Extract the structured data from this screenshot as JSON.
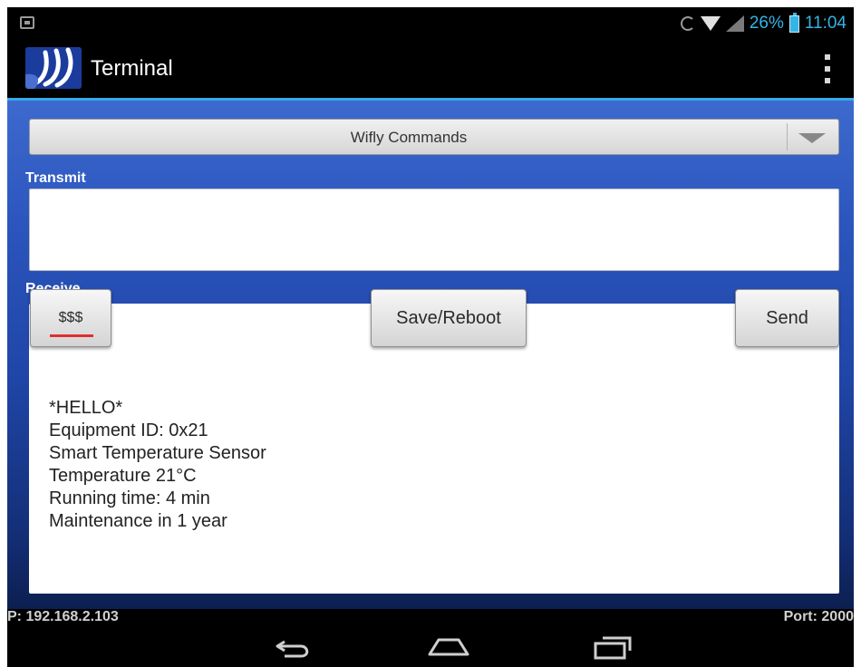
{
  "status_bar": {
    "battery": "26%",
    "time": "11:04",
    "icons": [
      "notification-icon",
      "sync-icon",
      "wifi-icon",
      "signal-icon",
      "battery-icon"
    ]
  },
  "action_bar": {
    "title": "Terminal",
    "logo": "rn-logo",
    "menu_icon": "overflow-menu-icon"
  },
  "spinner": {
    "selected": "Wifly Commands"
  },
  "transmit": {
    "label": "Transmit",
    "value": ""
  },
  "receive": {
    "label": "Receive",
    "lines": [
      "*HELLO*",
      "Equipment ID: 0x21",
      "Smart Temperature Sensor",
      "Temperature 21°C",
      "Running time: 4 min",
      "Maintenance in 1 year"
    ]
  },
  "buttons": {
    "sss": "$$$",
    "save_reboot": "Save/Reboot",
    "send": "Send"
  },
  "footer": {
    "ip": "P: 192.168.2.103",
    "port": "Port: 2000"
  },
  "nav_bar": {
    "icons": [
      "back-icon",
      "home-icon",
      "recent-apps-icon"
    ]
  },
  "colors": {
    "accent": "#33b5e5",
    "content_bg": "#2b55bd",
    "sss_underline": "#e03030"
  }
}
